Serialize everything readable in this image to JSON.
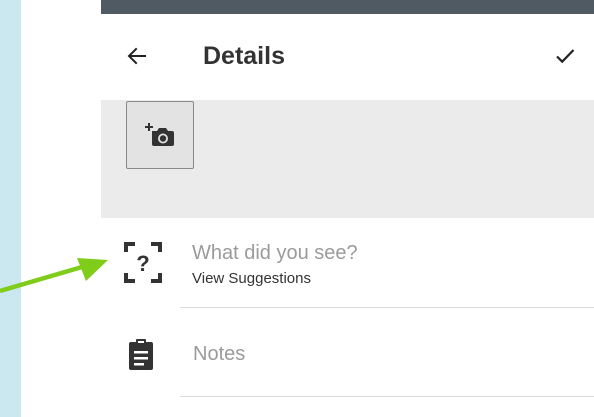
{
  "header": {
    "title": "Details",
    "back_icon": "arrow-left-icon",
    "confirm_icon": "checkmark-icon"
  },
  "photo": {
    "add_icon": "add-photo-camera-icon"
  },
  "species": {
    "icon": "question-scan-icon",
    "placeholder": "What did you see?",
    "suggestions_link": "View Suggestions"
  },
  "notes": {
    "icon": "clipboard-icon",
    "placeholder": "Notes"
  },
  "annotation": {
    "arrow_color": "#7fcc1a"
  },
  "colors": {
    "background": "#cbe7ef",
    "status_bar": "#505a63",
    "photo_strip": "#ebebeb",
    "placeholder_text": "#9b9b9b"
  }
}
